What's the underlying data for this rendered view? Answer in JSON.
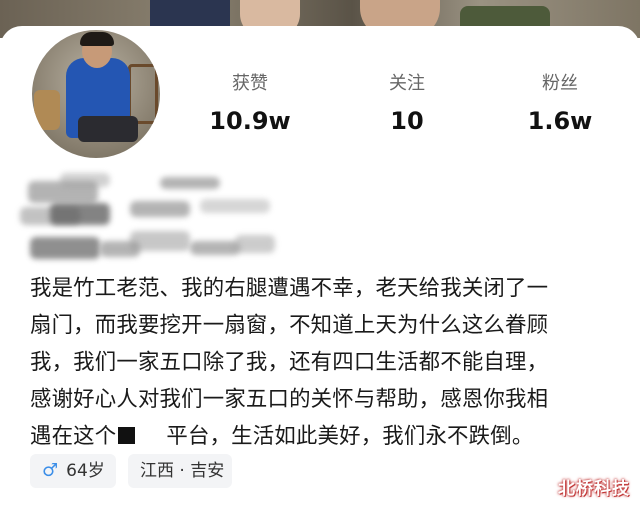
{
  "profile": {
    "stats": [
      {
        "label": "获赞",
        "value": "10.9w"
      },
      {
        "label": "关注",
        "value": "10"
      },
      {
        "label": "粉丝",
        "value": "1.6w"
      }
    ],
    "bio": {
      "line1": "我是竹工老范、我的右腿遭遇不幸，老天给我关闭了一",
      "line2": "扇门，而我要挖开一扇窗，不知道上天为什么这么眷顾",
      "line3": "我，我们一家五口除了我，还有四口生活都不能自理，",
      "line4": "感谢好心人对我们一家五口的关怀与帮助，感恩你我相",
      "line5_pre": "遇在这个",
      "line5_post": "平台，生活如此美好，我们永不跌倒。"
    },
    "tags": {
      "gender_icon": "male-icon",
      "age": "64岁",
      "location": "江西 · 吉安"
    }
  },
  "watermark": "北桥科技",
  "colors": {
    "gender_icon": "#3b8ee8",
    "stat_label": "#666666",
    "tag_bg": "#f3f4f6"
  }
}
